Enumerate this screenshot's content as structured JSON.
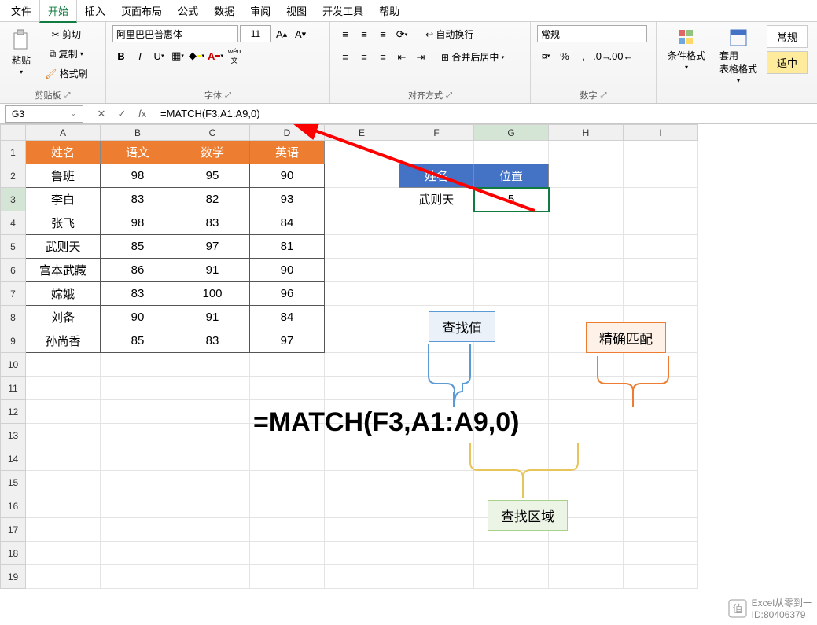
{
  "menubar": [
    "文件",
    "开始",
    "插入",
    "页面布局",
    "公式",
    "数据",
    "审阅",
    "视图",
    "开发工具",
    "帮助"
  ],
  "ribbon": {
    "clipboard": {
      "paste": "粘贴",
      "cut": "剪切",
      "copy": "复制",
      "fmtpaint": "格式刷",
      "label": "剪贴板"
    },
    "font": {
      "name": "阿里巴巴普惠体",
      "size": "11",
      "label": "字体",
      "wen": "wén"
    },
    "align": {
      "wrap": "自动换行",
      "merge": "合并后居中",
      "label": "对齐方式"
    },
    "number": {
      "fmt": "常规",
      "label": "数字"
    },
    "styles": {
      "cond": "条件格式",
      "table": "套用\n表格格式",
      "normal": "常规",
      "good": "适中"
    }
  },
  "namebox": "G3",
  "formula": "=MATCH(F3,A1:A9,0)",
  "cols": [
    "A",
    "B",
    "C",
    "D",
    "E",
    "F",
    "G",
    "H",
    "I"
  ],
  "t1_head": [
    "姓名",
    "语文",
    "数学",
    "英语"
  ],
  "t1": [
    [
      "鲁班",
      "98",
      "95",
      "90"
    ],
    [
      "李白",
      "83",
      "82",
      "93"
    ],
    [
      "张飞",
      "98",
      "83",
      "84"
    ],
    [
      "武则天",
      "85",
      "97",
      "81"
    ],
    [
      "宫本武藏",
      "86",
      "91",
      "90"
    ],
    [
      "嫦娥",
      "83",
      "100",
      "96"
    ],
    [
      "刘备",
      "90",
      "91",
      "84"
    ],
    [
      "孙尚香",
      "85",
      "83",
      "97"
    ]
  ],
  "t2_head": [
    "姓名",
    "位置"
  ],
  "t2": [
    "武则天",
    "5"
  ],
  "labels": {
    "lookup_value": "查找值",
    "exact_match": "精确匹配",
    "lookup_range": "查找区域"
  },
  "formula_display": "=MATCH(F3,A1:A9,0)",
  "watermark": {
    "title": "Excel从零到一",
    "id": "ID:80406379"
  }
}
